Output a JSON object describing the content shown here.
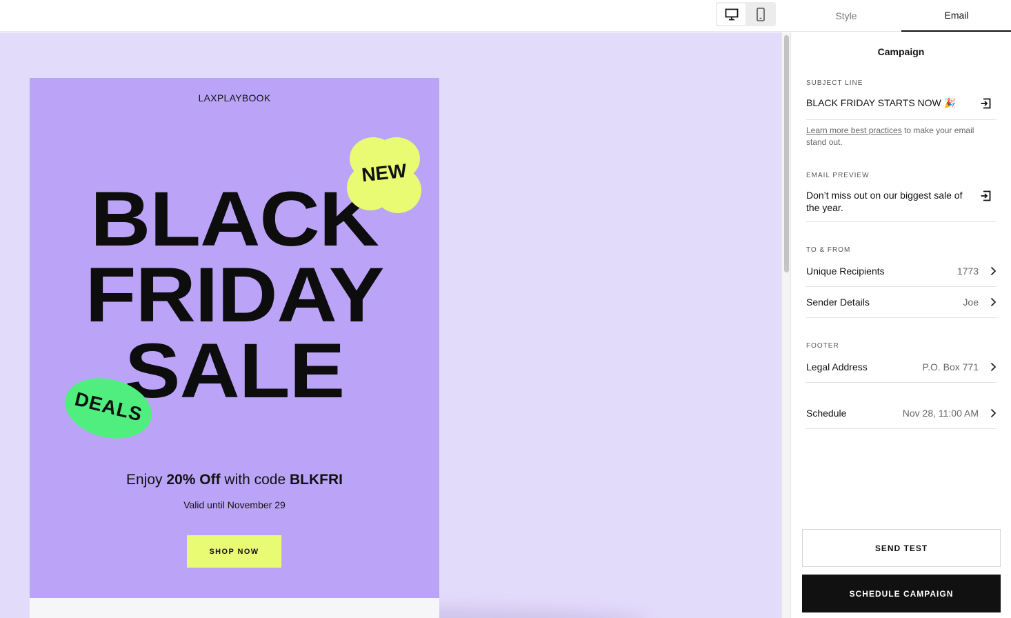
{
  "topbar": {
    "device_toggle": {
      "desktop_icon": "desktop-monitor-icon",
      "mobile_icon": "mobile-phone-icon",
      "selected": "desktop"
    },
    "tabs": [
      {
        "label": "Style",
        "active": false
      },
      {
        "label": "Email",
        "active": true
      }
    ]
  },
  "email": {
    "brand": "LAXPLAYBOOK",
    "headline": [
      "BLACK",
      "FRIDAY",
      "SALE"
    ],
    "badge_new": "NEW",
    "badge_deals": "DEALS",
    "offer": {
      "prefix": "Enjoy ",
      "discount": "20% Off",
      "middle": " with code ",
      "code": "BLKFRI"
    },
    "valid": "Valid until November 29",
    "cta": "SHOP NOW",
    "colors": {
      "background": "#e3dbfa",
      "card": "#bba4f8",
      "accent_yellow": "#e8fb72",
      "accent_green": "#4fee7e"
    }
  },
  "panel": {
    "title": "Campaign",
    "subject": {
      "label": "SUBJECT LINE",
      "value": "BLACK FRIDAY STARTS NOW 🎉"
    },
    "help": {
      "link": "Learn more best practices",
      "rest": " to make your email stand out."
    },
    "preview": {
      "label": "EMAIL PREVIEW",
      "value": "Don’t miss out on our biggest sale of the year."
    },
    "to_from": {
      "label": "TO & FROM",
      "recipients": {
        "label": "Unique Recipients",
        "value": "1773"
      },
      "sender": {
        "label": "Sender Details",
        "value": "Joe"
      }
    },
    "footer": {
      "label": "FOOTER",
      "address": {
        "label": "Legal Address",
        "value": "P.O. Box 771"
      }
    },
    "schedule": {
      "label": "Schedule",
      "value": "Nov 28, 11:00 AM"
    },
    "buttons": {
      "send_test": "SEND TEST",
      "schedule": "SCHEDULE CAMPAIGN"
    }
  }
}
